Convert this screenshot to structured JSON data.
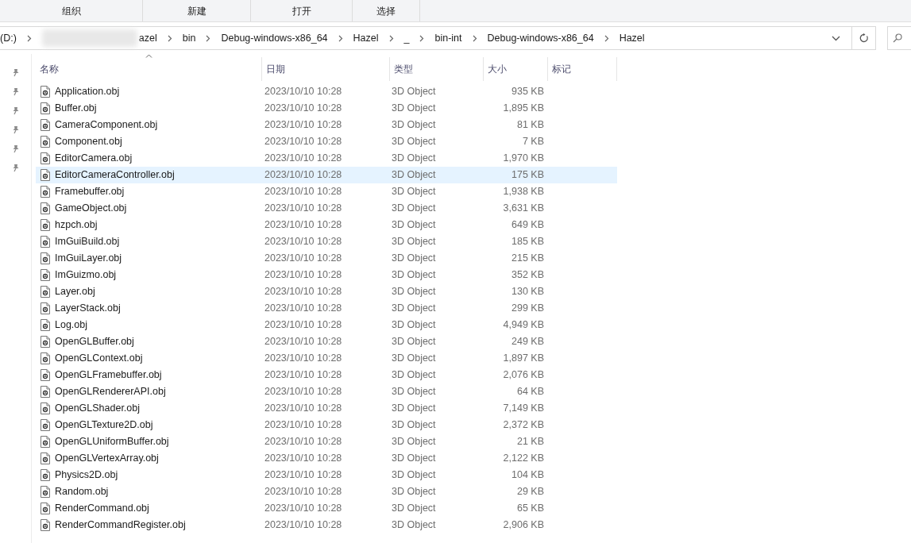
{
  "toolbar": [
    "组织",
    "新建",
    "打开",
    "选择"
  ],
  "breadcrumb": [
    "(D:)",
    "azel",
    "bin",
    "Debug-windows-x86_64",
    "Hazel",
    "_",
    "bin-int",
    "Debug-windows-x86_64",
    "Hazel"
  ],
  "columns": [
    "名称",
    "日期",
    "类型",
    "大小",
    "标记"
  ],
  "rows": [
    {
      "name": "Application.obj",
      "date": "2023/10/10 10:28",
      "type": "3D Object",
      "size": "935 KB",
      "selected": false
    },
    {
      "name": "Buffer.obj",
      "date": "2023/10/10 10:28",
      "type": "3D Object",
      "size": "1,895 KB",
      "selected": false
    },
    {
      "name": "CameraComponent.obj",
      "date": "2023/10/10 10:28",
      "type": "3D Object",
      "size": "81 KB",
      "selected": false
    },
    {
      "name": "Component.obj",
      "date": "2023/10/10 10:28",
      "type": "3D Object",
      "size": "7 KB",
      "selected": false
    },
    {
      "name": "EditorCamera.obj",
      "date": "2023/10/10 10:28",
      "type": "3D Object",
      "size": "1,970 KB",
      "selected": false
    },
    {
      "name": "EditorCameraController.obj",
      "date": "2023/10/10 10:28",
      "type": "3D Object",
      "size": "175 KB",
      "selected": true
    },
    {
      "name": "Framebuffer.obj",
      "date": "2023/10/10 10:28",
      "type": "3D Object",
      "size": "1,938 KB",
      "selected": false
    },
    {
      "name": "GameObject.obj",
      "date": "2023/10/10 10:28",
      "type": "3D Object",
      "size": "3,631 KB",
      "selected": false
    },
    {
      "name": "hzpch.obj",
      "date": "2023/10/10 10:28",
      "type": "3D Object",
      "size": "649 KB",
      "selected": false
    },
    {
      "name": "ImGuiBuild.obj",
      "date": "2023/10/10 10:28",
      "type": "3D Object",
      "size": "185 KB",
      "selected": false
    },
    {
      "name": "ImGuiLayer.obj",
      "date": "2023/10/10 10:28",
      "type": "3D Object",
      "size": "215 KB",
      "selected": false
    },
    {
      "name": "ImGuizmo.obj",
      "date": "2023/10/10 10:28",
      "type": "3D Object",
      "size": "352 KB",
      "selected": false
    },
    {
      "name": "Layer.obj",
      "date": "2023/10/10 10:28",
      "type": "3D Object",
      "size": "130 KB",
      "selected": false
    },
    {
      "name": "LayerStack.obj",
      "date": "2023/10/10 10:28",
      "type": "3D Object",
      "size": "299 KB",
      "selected": false
    },
    {
      "name": "Log.obj",
      "date": "2023/10/10 10:28",
      "type": "3D Object",
      "size": "4,949 KB",
      "selected": false
    },
    {
      "name": "OpenGLBuffer.obj",
      "date": "2023/10/10 10:28",
      "type": "3D Object",
      "size": "249 KB",
      "selected": false
    },
    {
      "name": "OpenGLContext.obj",
      "date": "2023/10/10 10:28",
      "type": "3D Object",
      "size": "1,897 KB",
      "selected": false
    },
    {
      "name": "OpenGLFramebuffer.obj",
      "date": "2023/10/10 10:28",
      "type": "3D Object",
      "size": "2,076 KB",
      "selected": false
    },
    {
      "name": "OpenGLRendererAPI.obj",
      "date": "2023/10/10 10:28",
      "type": "3D Object",
      "size": "64 KB",
      "selected": false
    },
    {
      "name": "OpenGLShader.obj",
      "date": "2023/10/10 10:28",
      "type": "3D Object",
      "size": "7,149 KB",
      "selected": false
    },
    {
      "name": "OpenGLTexture2D.obj",
      "date": "2023/10/10 10:28",
      "type": "3D Object",
      "size": "2,372 KB",
      "selected": false
    },
    {
      "name": "OpenGLUniformBuffer.obj",
      "date": "2023/10/10 10:28",
      "type": "3D Object",
      "size": "21 KB",
      "selected": false
    },
    {
      "name": "OpenGLVertexArray.obj",
      "date": "2023/10/10 10:28",
      "type": "3D Object",
      "size": "2,122 KB",
      "selected": false
    },
    {
      "name": "Physics2D.obj",
      "date": "2023/10/10 10:28",
      "type": "3D Object",
      "size": "104 KB",
      "selected": false
    },
    {
      "name": "Random.obj",
      "date": "2023/10/10 10:28",
      "type": "3D Object",
      "size": "29 KB",
      "selected": false
    },
    {
      "name": "RenderCommand.obj",
      "date": "2023/10/10 10:28",
      "type": "3D Object",
      "size": "65 KB",
      "selected": false
    },
    {
      "name": "RenderCommandRegister.obj",
      "date": "2023/10/10 10:28",
      "type": "3D Object",
      "size": "2,906 KB",
      "selected": false
    }
  ]
}
